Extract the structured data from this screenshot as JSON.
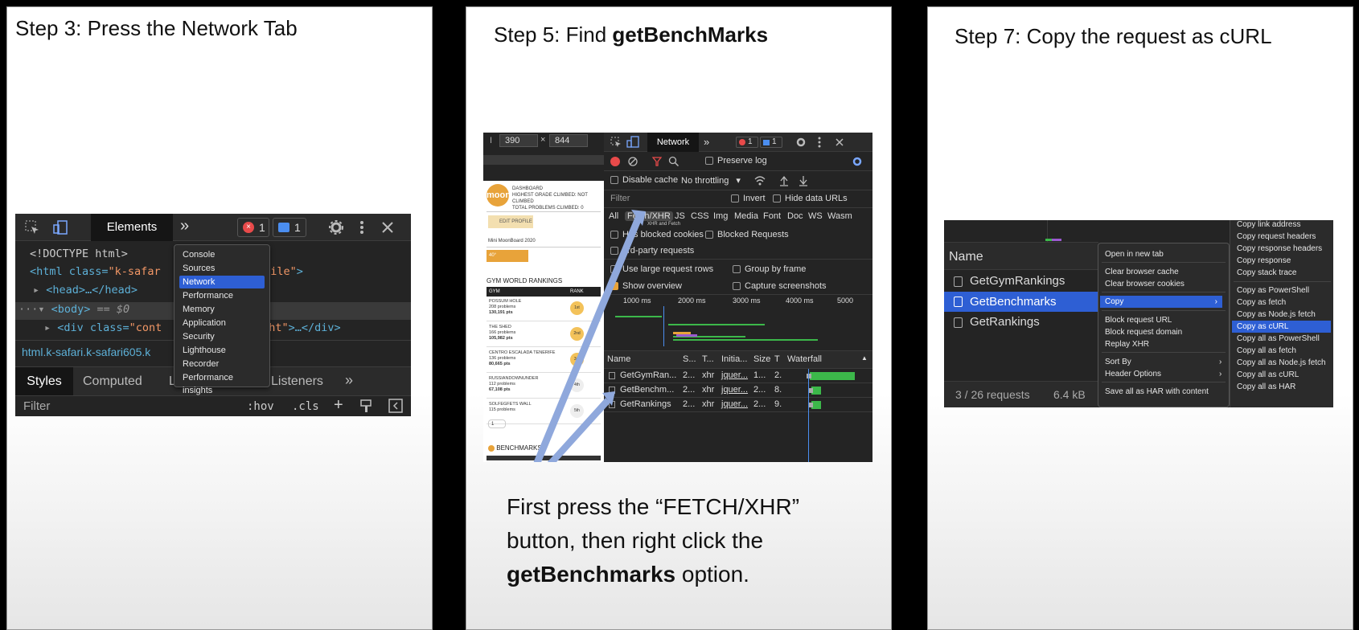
{
  "panel1": {
    "title": "Step 3: Press the Network Tab",
    "tabs": {
      "elements": "Elements",
      "more": "»",
      "errors": "1",
      "messages": "1"
    },
    "code": {
      "line1": "<!DOCTYPE html>",
      "line2_tag": "<html class=",
      "line2_val1": "\"k-safar",
      "line2_val2": "k-mobile\"",
      "line2_end": ">",
      "line3": "<head>…</head>",
      "line4_tag": "<body>",
      "line4_eq": " == $0",
      "line5_tag": "<div class=",
      "line5_val1": "\"cont",
      "line5_val2": "ullheight\"",
      "line5_end": ">…</div>",
      "breadcrumb": "html.k-safari.k-safari605.k"
    },
    "menu": [
      "Console",
      "Sources",
      "Network",
      "Performance",
      "Memory",
      "Application",
      "Security",
      "Lighthouse",
      "Recorder",
      "Performance insights"
    ],
    "subtabs": {
      "styles": "Styles",
      "computed": "Computed",
      "l": "L",
      "listeners": "Listeners",
      "more": "»"
    },
    "filter": {
      "placeholder": "Filter",
      "hov": ":hov",
      "cls": ".cls",
      "plus": "+"
    }
  },
  "panel2": {
    "title_prefix": "Step 5: Find ",
    "title_bold": "getBenchMarks",
    "device": {
      "width": "390",
      "height": "844",
      "times": "×"
    },
    "network_tab": "Network",
    "counts": {
      "errors": "1",
      "messages": "1"
    },
    "options": {
      "preserve_log": "Preserve log",
      "disable_cache": "Disable cache",
      "throttling": "No throttling",
      "filter": "Filter",
      "invert": "Invert",
      "hide_data_urls": "Hide data URLs",
      "has_blocked_cookies": "Has blocked cookies",
      "blocked_requests": "Blocked Requests",
      "third_party": "3rd-party requests",
      "large_rows": "Use large request rows",
      "group_by_frame": "Group by frame",
      "show_overview": "Show overview",
      "capture_screenshots": "Capture screenshots"
    },
    "types": [
      "All",
      "Fetch/XHR",
      "JS",
      "CSS",
      "Img",
      "Media",
      "Font",
      "Doc",
      "WS",
      "Wasm"
    ],
    "tooltip": "XHR and Fetch",
    "timeline": [
      "1000 ms",
      "2000 ms",
      "3000 ms",
      "4000 ms",
      "5000"
    ],
    "table_headers": [
      "Name",
      "S...",
      "T...",
      "Initia...",
      "Size",
      "T",
      "Waterfall"
    ],
    "rows": [
      {
        "name": "GetGymRan...",
        "status": "2...",
        "type": "xhr",
        "init": "jquer...",
        "size": "1...",
        "t": "2."
      },
      {
        "name": "GetBenchm...",
        "status": "2...",
        "type": "xhr",
        "init": "jquer...",
        "size": "2...",
        "t": "8."
      },
      {
        "name": "GetRankings",
        "status": "2...",
        "type": "xhr",
        "init": "jquer...",
        "size": "2...",
        "t": "9."
      }
    ],
    "mobile": {
      "logo": "moon",
      "dash1": "DASHBOARD",
      "dash2": "HIGHEST GRADE CLIMBED: NOT CLIMBED",
      "dash3": "TOTAL PROBLEMS CLIMBED: 0",
      "edit": "EDIT PROFILE",
      "board": "Mini MoonBoard 2020",
      "angle": "40° MOONBOARD",
      "rankings": "GYM WORLD RANKINGS",
      "gym_col": "GYM",
      "rank_col": "RANK",
      "gyms": [
        {
          "name": "POSSUM HOLE",
          "problems": "208 problems",
          "pts": "130,191 pts",
          "rank": "1st"
        },
        {
          "name": "THE SHED",
          "problems": "166 problems",
          "pts": "105,982 pts",
          "rank": "2nd"
        },
        {
          "name": "CENTRO ESCALADA TENERIFE",
          "problems": "136 problems",
          "pts": "80,665 pts",
          "rank": "3rd"
        },
        {
          "name": "RUSSIANDOWNUNDER",
          "problems": "112 problems",
          "pts": "67,108 pts",
          "rank": "4th"
        },
        {
          "name": "SOLFEGFETS WALL",
          "problems": "115 problems",
          "pts": "",
          "rank": "5th"
        }
      ],
      "page": "1",
      "benchmarks": "BENCHMARKS"
    },
    "caption_line1": "First press the “FETCH/XHR”",
    "caption_line2": "button, then right click the",
    "caption_bold": "getBenchmarks",
    "caption_end": " option."
  },
  "panel3": {
    "title": "Step 7: Copy the request as cURL",
    "name_header": "Name",
    "rows": [
      "GetGymRankings",
      "GetBenchmarks",
      "GetRankings"
    ],
    "footer_requests": "3 / 26 requests",
    "footer_size": "6.4 kB",
    "menu1": [
      "Open in new tab",
      "Clear browser cache",
      "Clear browser cookies",
      "Copy",
      "Block request URL",
      "Block request domain",
      "Replay XHR",
      "Sort By",
      "Header Options",
      "Save all as HAR with content"
    ],
    "menu2": [
      "Copy link address",
      "Copy request headers",
      "Copy response headers",
      "Copy response",
      "Copy stack trace",
      "Copy as PowerShell",
      "Copy as fetch",
      "Copy as Node.js fetch",
      "Copy as cURL",
      "Copy all as PowerShell",
      "Copy all as fetch",
      "Copy all as Node.js fetch",
      "Copy all as cURL",
      "Copy all as HAR"
    ],
    "arrow": "›"
  },
  "colors": {
    "selection": "#2e5fd4",
    "devtools_bg": "#242424",
    "accent_orange": "#e8a33a",
    "arrow": "#8fa8dc"
  }
}
